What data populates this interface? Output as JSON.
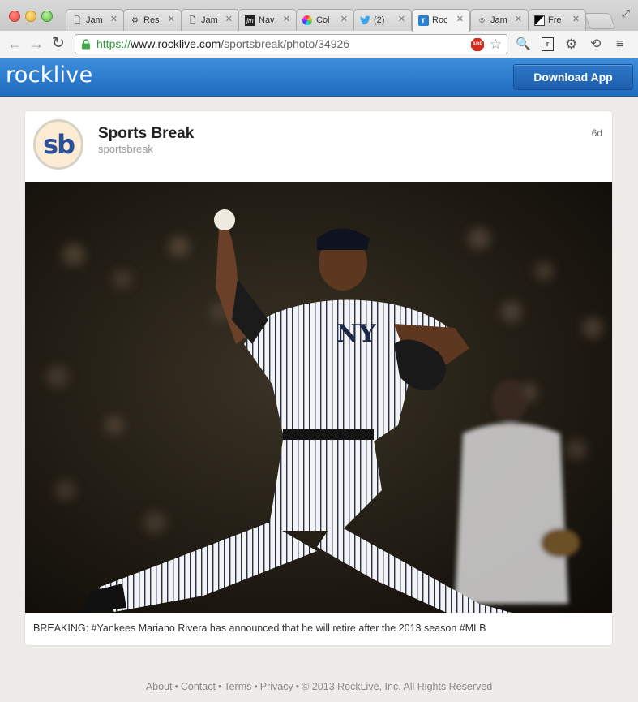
{
  "browser": {
    "tabs": [
      {
        "label": "Jam",
        "icon": "page-icon",
        "active": false
      },
      {
        "label": "Res",
        "icon": "gear-icon",
        "active": false
      },
      {
        "label": "Jam",
        "icon": "page-icon",
        "active": false
      },
      {
        "label": "Nav",
        "icon": "jm-icon",
        "active": false
      },
      {
        "label": "Col",
        "icon": "color-wheel-icon",
        "active": false
      },
      {
        "label": "(2)",
        "icon": "twitter-bird-icon",
        "active": false
      },
      {
        "label": "Roc",
        "icon": "rocklive-icon",
        "active": true
      },
      {
        "label": "Jam",
        "icon": "smiley-icon",
        "active": false
      },
      {
        "label": "Fre",
        "icon": "contrast-icon",
        "active": false
      }
    ],
    "url_scheme": "https://",
    "url_host": "www.rocklive.com",
    "url_path": "/sportsbreak/photo/34926",
    "abp_label": "ABP"
  },
  "site": {
    "logo": "rocklive",
    "download_label": "Download App"
  },
  "post": {
    "avatar_text": "sb",
    "poster_name": "Sports Break",
    "poster_handle": "sportsbreak",
    "age": "6d",
    "caption": "BREAKING: #Yankees Mariano Rivera has announced that he will retire after the 2013 season #MLB"
  },
  "footer": {
    "links": [
      "About",
      "Contact",
      "Terms",
      "Privacy"
    ],
    "copyright": "© 2013 RockLive, Inc. All Rights Reserved"
  }
}
